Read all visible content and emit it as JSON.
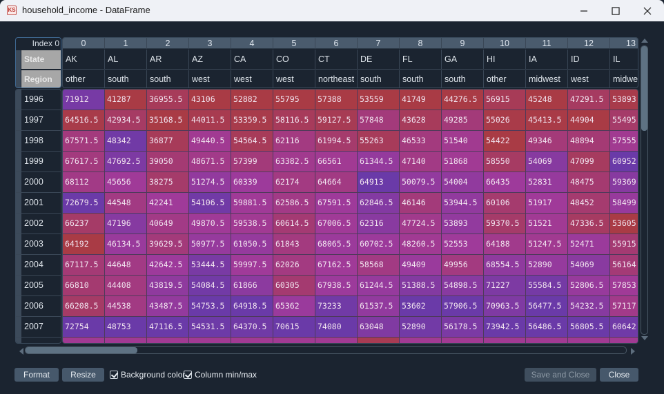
{
  "window": {
    "title": "household_income - DataFrame",
    "app_icon": "spyder-variable-explorer-icon",
    "controls": [
      "minimize",
      "maximize",
      "close"
    ]
  },
  "header": {
    "index_label": "Index 0",
    "level_labels": [
      "State",
      "Region"
    ],
    "columns": [
      {
        "num": "0",
        "state": "AK",
        "region": "other"
      },
      {
        "num": "1",
        "state": "AL",
        "region": "south"
      },
      {
        "num": "2",
        "state": "AR",
        "region": "south"
      },
      {
        "num": "3",
        "state": "AZ",
        "region": "west"
      },
      {
        "num": "4",
        "state": "CA",
        "region": "west"
      },
      {
        "num": "5",
        "state": "CO",
        "region": "west"
      },
      {
        "num": "6",
        "state": "CT",
        "region": "northeast"
      },
      {
        "num": "7",
        "state": "DE",
        "region": "south"
      },
      {
        "num": "8",
        "state": "FL",
        "region": "south"
      },
      {
        "num": "9",
        "state": "GA",
        "region": "south"
      },
      {
        "num": "10",
        "state": "HI",
        "region": "other"
      },
      {
        "num": "11",
        "state": "IA",
        "region": "midwest"
      },
      {
        "num": "12",
        "state": "ID",
        "region": "west"
      },
      {
        "num": "13",
        "state": "IL",
        "region": "midwest"
      }
    ]
  },
  "rows": [
    {
      "label": "1996",
      "values": [
        "71912",
        "41287",
        "36955.5",
        "43106",
        "52882",
        "55795",
        "57388",
        "53559",
        "41749",
        "44276.5",
        "56915",
        "45248",
        "47291.5",
        "53893"
      ]
    },
    {
      "label": "1997",
      "values": [
        "64516.5",
        "42934.5",
        "35168.5",
        "44011.5",
        "53359.5",
        "58116.5",
        "59127.5",
        "57848",
        "43628",
        "49285",
        "55026",
        "45413.5",
        "44904",
        "55495"
      ]
    },
    {
      "label": "1998",
      "values": [
        "67571.5",
        "48342",
        "36877",
        "49440.5",
        "54564.5",
        "62116",
        "61994.5",
        "55263",
        "46533",
        "51540",
        "54422",
        "49346",
        "48894",
        "57555"
      ]
    },
    {
      "label": "1999",
      "values": [
        "67617.5",
        "47692.5",
        "39050",
        "48671.5",
        "57399",
        "63382.5",
        "66561",
        "61344.5",
        "47140",
        "51868",
        "58550",
        "54069",
        "47099",
        "60952"
      ]
    },
    {
      "label": "2000",
      "values": [
        "68112",
        "45656",
        "38275",
        "51274.5",
        "60339",
        "62174",
        "64664",
        "64913",
        "50079.5",
        "54004",
        "66435",
        "52831",
        "48475",
        "59369"
      ]
    },
    {
      "label": "2001",
      "values": [
        "72679.5",
        "44548",
        "42241",
        "54106.5",
        "59881.5",
        "62586.5",
        "67591.5",
        "62846.5",
        "46146",
        "53944.5",
        "60106",
        "51917",
        "48452",
        "58499"
      ]
    },
    {
      "label": "2002",
      "values": [
        "66237",
        "47196",
        "40649",
        "49870.5",
        "59538.5",
        "60614.5",
        "67006.5",
        "62316",
        "47724.5",
        "53893",
        "59370.5",
        "51521",
        "47336.5",
        "53605"
      ]
    },
    {
      "label": "2003",
      "values": [
        "64192",
        "46134.5",
        "39629.5",
        "50977.5",
        "61050.5",
        "61843",
        "68065.5",
        "60702.5",
        "48260.5",
        "52553",
        "64188",
        "51247.5",
        "52471",
        "55915"
      ]
    },
    {
      "label": "2004",
      "values": [
        "67117.5",
        "44648",
        "42642.5",
        "53444.5",
        "59997.5",
        "62026",
        "67162.5",
        "58568",
        "49409",
        "49956",
        "68554.5",
        "52890",
        "54069",
        "56164"
      ]
    },
    {
      "label": "2005",
      "values": [
        "66810",
        "44408",
        "43819.5",
        "54084.5",
        "61866",
        "60305",
        "67938.5",
        "61244.5",
        "51388.5",
        "54898.5",
        "71227",
        "55584.5",
        "52806.5",
        "57853"
      ]
    },
    {
      "label": "2006",
      "values": [
        "66208.5",
        "44538",
        "43487.5",
        "54753.5",
        "64918.5",
        "65362",
        "73233",
        "61537.5",
        "53602",
        "57906.5",
        "70963.5",
        "56477.5",
        "54232.5",
        "57117"
      ]
    },
    {
      "label": "2007",
      "values": [
        "72754",
        "48753",
        "47116.5",
        "54531.5",
        "64370.5",
        "70615",
        "74080",
        "63048",
        "52890",
        "56178.5",
        "73942.5",
        "56486.5",
        "56805.5",
        "60642"
      ]
    },
    {
      "label": "",
      "values": [
        "",
        "",
        "",
        "",
        "",
        "",
        "",
        "",
        "",
        "",
        "",
        "",
        "",
        ""
      ]
    }
  ],
  "colormap": {
    "low": "#a93b45",
    "mid": "#a03a9a",
    "high": "#6a3aa8"
  },
  "footer": {
    "format_label": "Format",
    "resize_label": "Resize",
    "background_color_label": "Background color",
    "background_color_checked": true,
    "column_minmax_label": "Column min/max",
    "column_minmax_checked": true,
    "save_close_label": "Save and Close",
    "save_close_enabled": false,
    "close_label": "Close"
  }
}
